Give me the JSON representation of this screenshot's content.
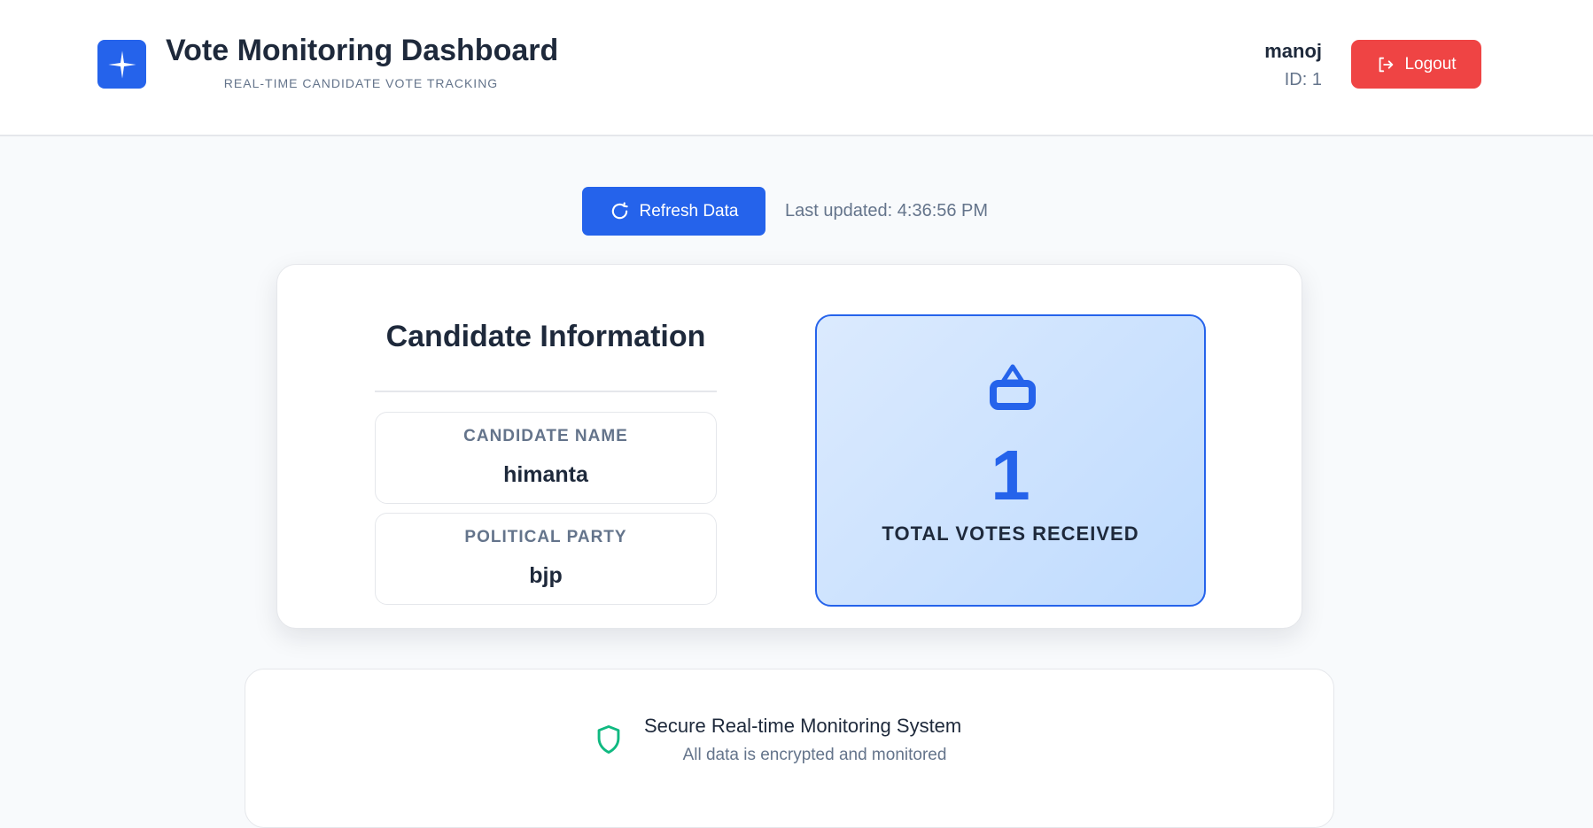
{
  "header": {
    "title": "Vote Monitoring Dashboard",
    "subtitle": "REAL-TIME CANDIDATE VOTE TRACKING",
    "logo_icon": "sparkle-icon",
    "user": {
      "name": "manoj",
      "id_text": "ID: 1"
    },
    "logout_label": "Logout",
    "logout_icon": "logout-icon"
  },
  "toolbar": {
    "refresh_label": "Refresh Data",
    "refresh_icon": "refresh-icon",
    "last_updated": "Last updated: 4:36:56 PM"
  },
  "candidate": {
    "section_title": "Candidate Information",
    "name_label": "CANDIDATE NAME",
    "name_value": "himanta",
    "party_label": "POLITICAL PARTY",
    "party_value": "bjp"
  },
  "votes": {
    "icon": "ballot-box-icon",
    "count": "1",
    "label": "TOTAL VOTES RECEIVED"
  },
  "footer": {
    "icon": "shield-icon",
    "title": "Secure Real-time Monitoring System",
    "subtitle": "All data is encrypted and monitored"
  },
  "colors": {
    "primary": "#2563eb",
    "danger": "#ef4444",
    "success": "#10b981",
    "text": "#1e293b",
    "muted": "#64748b"
  }
}
